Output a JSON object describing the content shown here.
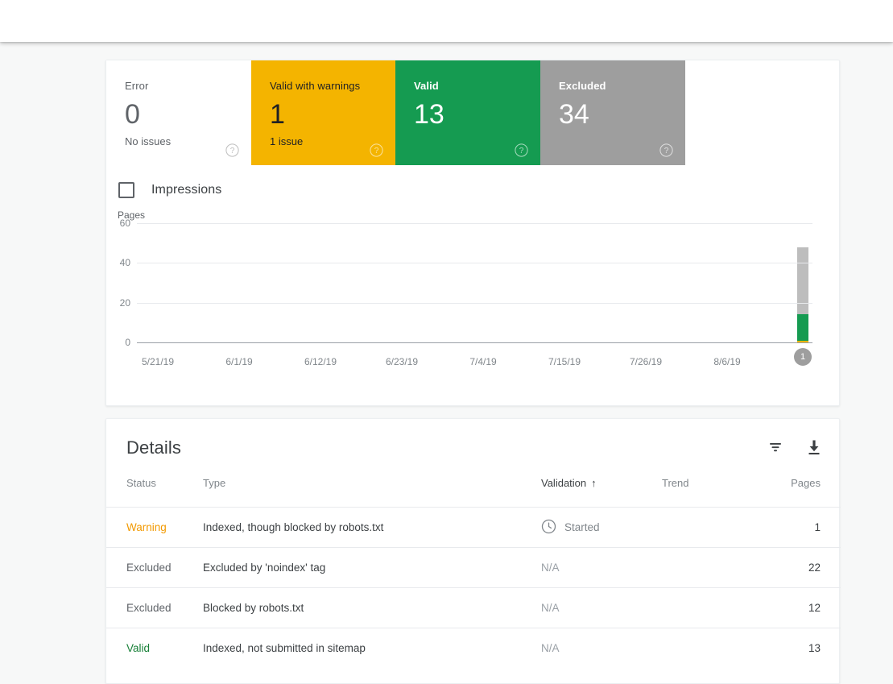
{
  "status_cards": [
    {
      "label": "Error",
      "value": "0",
      "sub": "No issues",
      "help": "help-icon",
      "color": "#ffffff"
    },
    {
      "label": "Valid with warnings",
      "value": "1",
      "sub": "1 issue",
      "help": "help-icon",
      "color": "#f4b400"
    },
    {
      "label": "Valid",
      "value": "13",
      "sub": "",
      "help": "help-icon",
      "color": "#159b51"
    },
    {
      "label": "Excluded",
      "value": "34",
      "sub": "",
      "help": "help-icon",
      "color": "#9e9e9e"
    }
  ],
  "legend": {
    "impressions_label": "Impressions",
    "impressions_checked": false
  },
  "chart_data": {
    "type": "bar",
    "title": "",
    "subtitle": "",
    "xlabel": "",
    "ylabel": "Pages",
    "ylim": [
      0,
      60
    ],
    "yticks": [
      60,
      40,
      20,
      0
    ],
    "grid": true,
    "legend_position": "top-left",
    "stacked": true,
    "x": [
      "5/21/19",
      "6/1/19",
      "6/12/19",
      "6/23/19",
      "7/4/19",
      "7/15/19",
      "7/26/19",
      "8/6/19"
    ],
    "xtick_labels": [
      "5/21/19",
      "6/1/19",
      "6/12/19",
      "6/23/19",
      "7/4/19",
      "7/15/19",
      "7/26/19",
      "8/6/19"
    ],
    "series": [
      {
        "name": "Excluded",
        "color": "#bdbdbd",
        "values": [
          0,
          0,
          0,
          0,
          0,
          0,
          0,
          0,
          34
        ]
      },
      {
        "name": "Valid",
        "color": "#159b51",
        "values": [
          0,
          0,
          0,
          0,
          0,
          0,
          0,
          0,
          13
        ]
      },
      {
        "name": "Warning",
        "color": "#f4b400",
        "values": [
          0,
          0,
          0,
          0,
          0,
          0,
          0,
          0,
          1
        ]
      }
    ],
    "last_bar": {
      "excluded": 34,
      "valid": 13,
      "warning": 1,
      "total": 48
    },
    "annotations": [
      {
        "type": "badge",
        "label": "1",
        "position": "below-last-bar"
      }
    ]
  },
  "details": {
    "title": "Details",
    "filter_icon": "filter-icon",
    "download_icon": "download-icon",
    "columns": {
      "status": "Status",
      "type": "Type",
      "validation": "Validation",
      "validation_sort": "↑",
      "trend": "Trend",
      "pages": "Pages"
    },
    "rows": [
      {
        "status": "Warning",
        "status_kind": "warning",
        "type": "Indexed, though blocked by robots.txt",
        "validation": "Started",
        "validation_icon": "clock-icon",
        "trend": "",
        "pages": "1"
      },
      {
        "status": "Excluded",
        "status_kind": "excluded",
        "type": "Excluded by 'noindex' tag",
        "validation": "N/A",
        "validation_icon": "",
        "trend": "",
        "pages": "22"
      },
      {
        "status": "Excluded",
        "status_kind": "excluded",
        "type": "Blocked by robots.txt",
        "validation": "N/A",
        "validation_icon": "",
        "trend": "",
        "pages": "12"
      },
      {
        "status": "Valid",
        "status_kind": "valid",
        "type": "Indexed, not submitted in sitemap",
        "validation": "N/A",
        "validation_icon": "",
        "trend": "",
        "pages": "13"
      }
    ]
  },
  "colors": {
    "error": "#5f6368",
    "warning": "#f4b400",
    "valid": "#159b51",
    "excluded": "#9e9e9e",
    "background": "#f7f8f8"
  }
}
